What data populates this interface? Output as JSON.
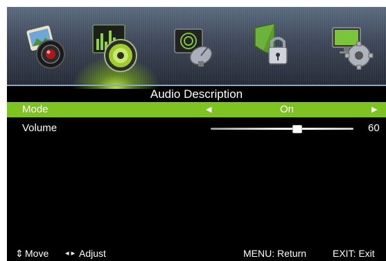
{
  "menu": {
    "categories": [
      {
        "id": "picture",
        "icon": "picture-icon",
        "selected": false
      },
      {
        "id": "sound",
        "icon": "sound-icon",
        "selected": true
      },
      {
        "id": "channel",
        "icon": "channel-icon",
        "selected": false
      },
      {
        "id": "lock",
        "icon": "lock-icon",
        "selected": false
      },
      {
        "id": "setup",
        "icon": "setup-icon",
        "selected": false
      }
    ],
    "title": "Audio Description",
    "items": [
      {
        "label": "Mode",
        "value": "On",
        "left_arrow": "◀",
        "right_arrow": "▶",
        "selected": true
      },
      {
        "label": "Volume",
        "value": "60",
        "level": 0.6,
        "selected": false
      }
    ]
  },
  "footer": {
    "move_icon": "⇕",
    "move_label": "Move",
    "adjust_icon": "◂ ▸",
    "adjust_label": "Adjust",
    "return_label": "MENU: Return",
    "exit_label": "EXIT: Exit"
  },
  "colors": {
    "highlight": "#7dc422",
    "background": "#000000",
    "text": "#ffffff"
  }
}
